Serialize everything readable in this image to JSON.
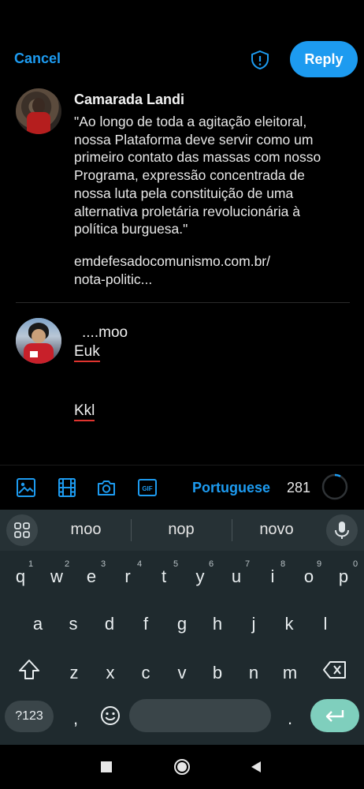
{
  "header": {
    "cancel_label": "Cancel",
    "reply_label": "Reply",
    "shield_icon": "shield-alert-icon",
    "accent_color": "#1d9bf0"
  },
  "quoted_post": {
    "author": "Camarada Landi",
    "text": "\"Ao longo de toda a agitação eleitoral, nossa Plataforma deve servir como um primeiro contato das massas com nosso Programa, expressão concentrada de nossa luta pela constituição de uma alternativa proletária revolucionária à política burguesa.\"",
    "link_line1": "emdefesadocomunismo.com.br/",
    "link_line2": "nota-politic..."
  },
  "compose": {
    "line1": "....moo",
    "line2": "Euk",
    "line3": "Kkl"
  },
  "toolbar": {
    "icons": [
      "image-icon",
      "video-icon",
      "camera-icon",
      "gif-icon"
    ],
    "language": "Portuguese",
    "char_count": "281"
  },
  "keyboard": {
    "suggestions": [
      "moo",
      "nop",
      "novo"
    ],
    "row1": [
      "q",
      "w",
      "e",
      "r",
      "t",
      "y",
      "u",
      "i",
      "o",
      "p"
    ],
    "row1_hints": [
      "1",
      "2",
      "3",
      "4",
      "5",
      "6",
      "7",
      "8",
      "9",
      "0"
    ],
    "row2": [
      "a",
      "s",
      "d",
      "f",
      "g",
      "h",
      "j",
      "k",
      "l"
    ],
    "row3": [
      "z",
      "x",
      "c",
      "v",
      "b",
      "n",
      "m"
    ],
    "symbols_label": "?123",
    "comma": ",",
    "period": ".",
    "enter_color": "#7fcfbd"
  },
  "navbar": {
    "icons": [
      "recents-icon",
      "home-icon",
      "back-icon"
    ]
  }
}
